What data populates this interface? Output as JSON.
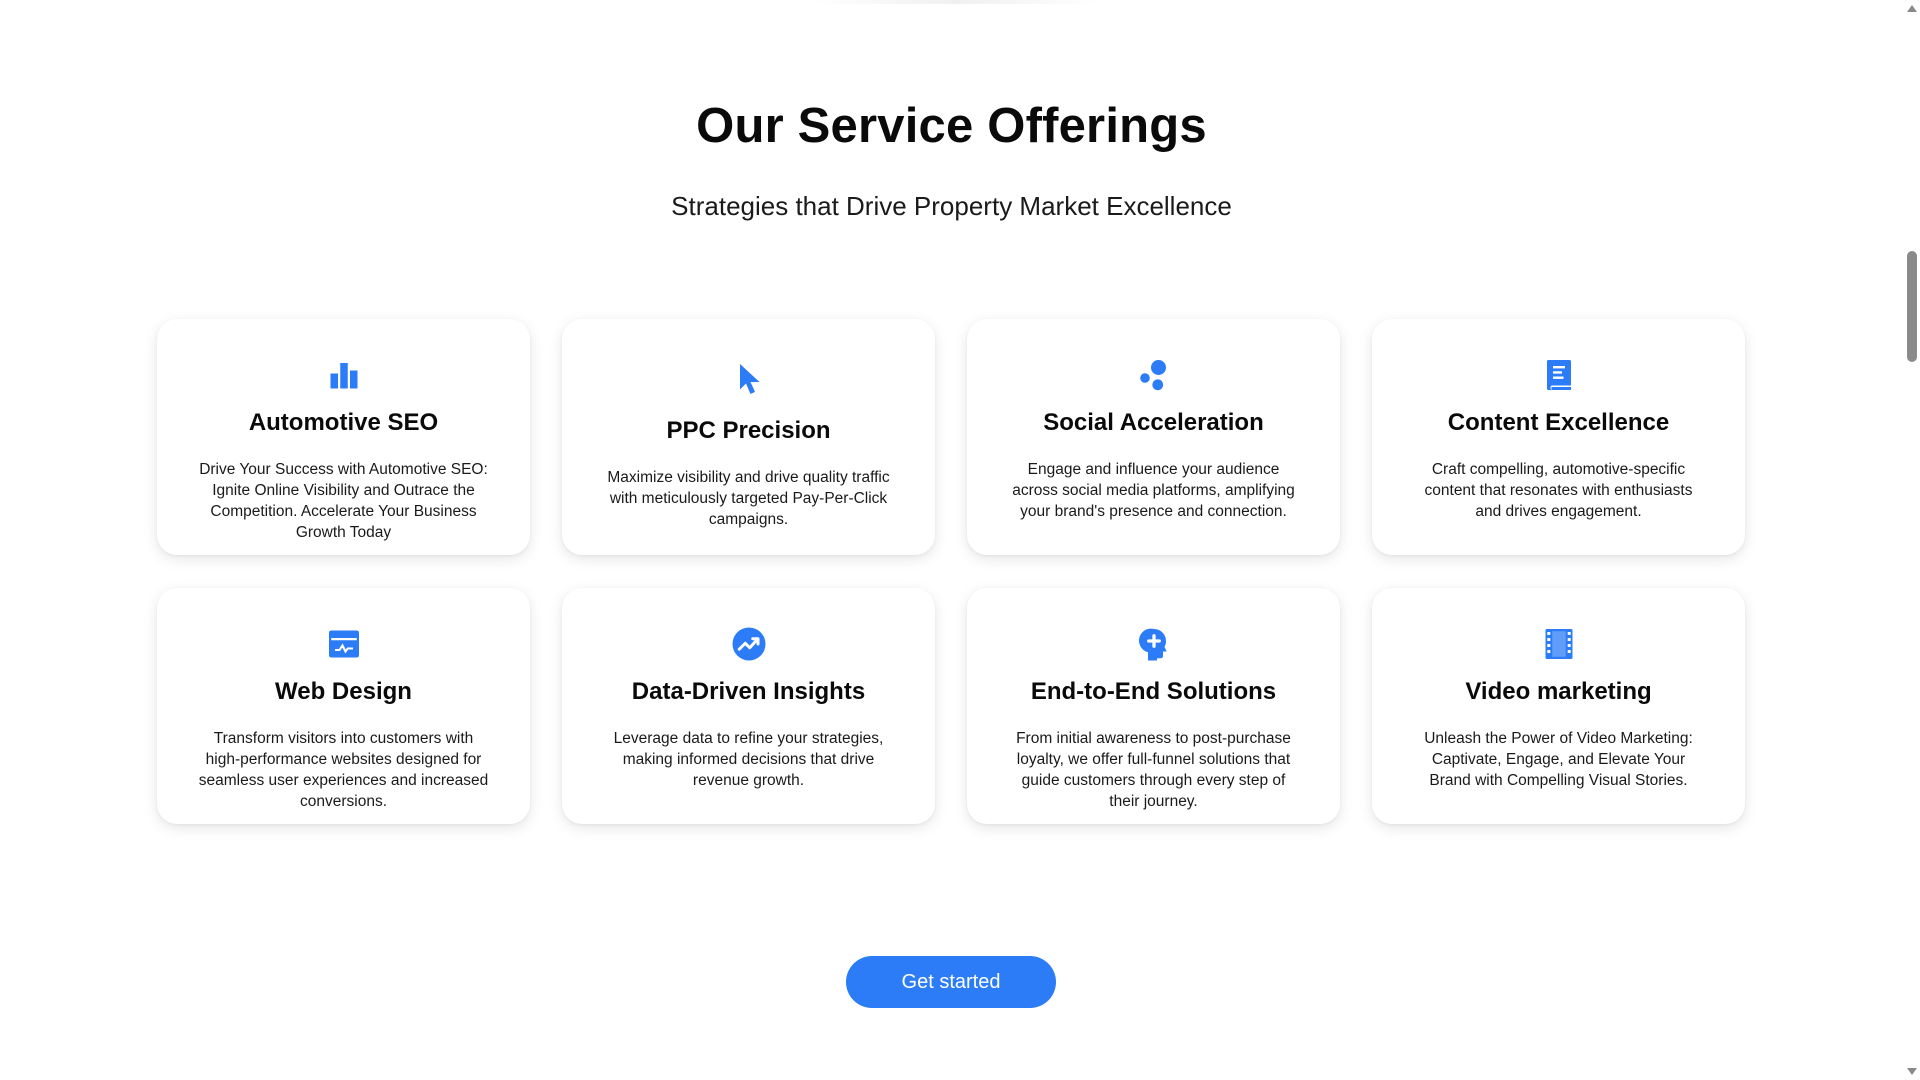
{
  "section": {
    "title": "Our Service Offerings",
    "subtitle": "Strategies that Drive Property Market Excellence"
  },
  "accent_color": "#2b7cf6",
  "services": [
    {
      "icon": "bar-chart-icon",
      "title": "Automotive SEO",
      "description": "Drive Your Success with Automotive SEO: Ignite Online Visibility and Outrace the Competition. Accelerate Your Business Growth Today"
    },
    {
      "icon": "cursor-pointer-icon",
      "title": "PPC Precision",
      "description": "Maximize visibility and drive quality traffic with meticulously targeted Pay-Per-Click campaigns."
    },
    {
      "icon": "social-bubbles-icon",
      "title": "Social Acceleration",
      "description": "Engage and influence your audience across social media platforms, amplifying your brand's presence and connection."
    },
    {
      "icon": "book-icon",
      "title": "Content Excellence",
      "description": "Craft compelling, automotive-specific content that resonates with enthusiasts and drives engagement."
    },
    {
      "icon": "web-browser-icon",
      "title": "Web Design",
      "description": "Transform visitors into customers with high-performance websites designed for seamless user experiences and increased conversions."
    },
    {
      "icon": "trending-up-icon",
      "title": "Data-Driven Insights",
      "description": "Leverage data to refine your strategies, making informed decisions that drive revenue growth."
    },
    {
      "icon": "head-idea-icon",
      "title": "End-to-End Solutions",
      "description": "From initial awareness to post-purchase loyalty, we offer full-funnel solutions that guide customers through every step of their journey."
    },
    {
      "icon": "film-strip-icon",
      "title": "Video marketing",
      "description": "Unleash the Power of Video Marketing: Captivate, Engage, and Elevate Your Brand with Compelling Visual Stories."
    }
  ],
  "cta": {
    "label": "Get started"
  }
}
